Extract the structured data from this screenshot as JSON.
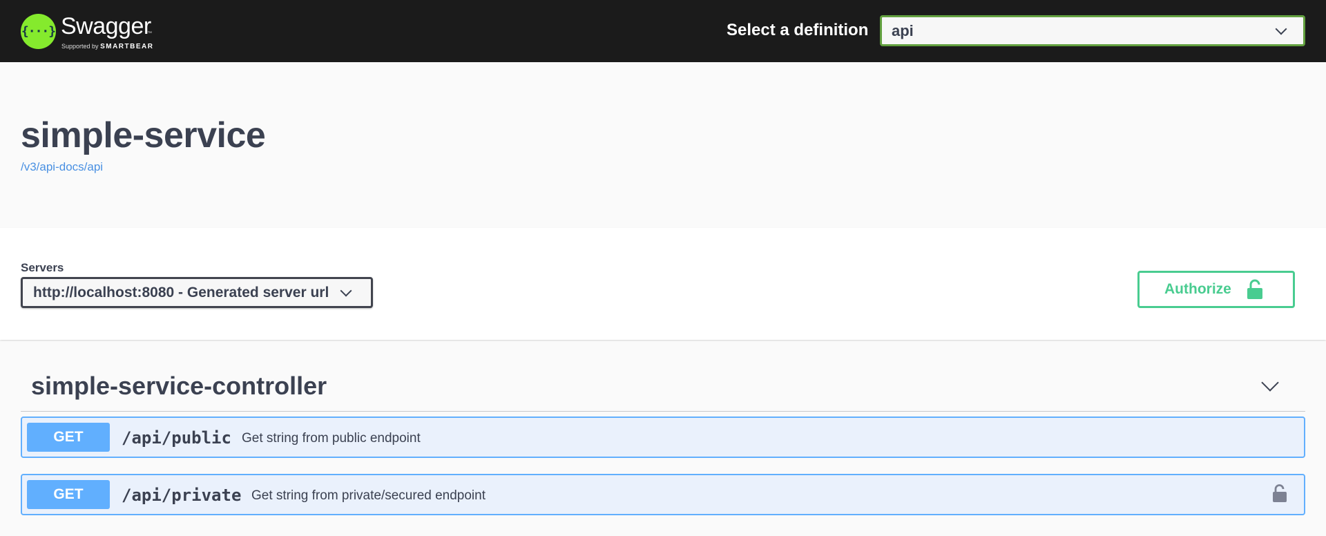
{
  "topbar": {
    "brand": {
      "logo_glyph": "{···}",
      "name": "Swagger",
      "tm": "™",
      "supported_by": "Supported by",
      "smartbear": "SMARTBEAR"
    },
    "definition_label": "Select a definition",
    "definition_value": "api"
  },
  "info": {
    "title": "simple-service",
    "url": "/v3/api-docs/api"
  },
  "scheme": {
    "servers_label": "Servers",
    "server_value": "http://localhost:8080 - Generated server url",
    "authorize_label": "Authorize"
  },
  "tag": {
    "name": "simple-service-controller"
  },
  "operations": [
    {
      "method": "GET",
      "path": "/api/public",
      "summary": "Get string from public endpoint",
      "locked": false
    },
    {
      "method": "GET",
      "path": "/api/private",
      "summary": "Get string from private/secured endpoint",
      "locked": true
    }
  ],
  "colors": {
    "topbar_bg": "#1b1b1b",
    "brand_green": "#85ea2d",
    "select_border": "#62a03f",
    "authorize_green": "#49cc90",
    "get_blue": "#61affe",
    "get_bg": "#eaf1fc",
    "link_blue": "#4990e2",
    "text_dark": "#3b4151"
  },
  "icons": {
    "definition_chevron": "chevron-down-icon",
    "server_chevron": "chevron-down-icon",
    "authorize_lock": "unlocked-icon",
    "tag_chevron": "chevron-down-icon",
    "operation_lock": "unlocked-icon"
  }
}
